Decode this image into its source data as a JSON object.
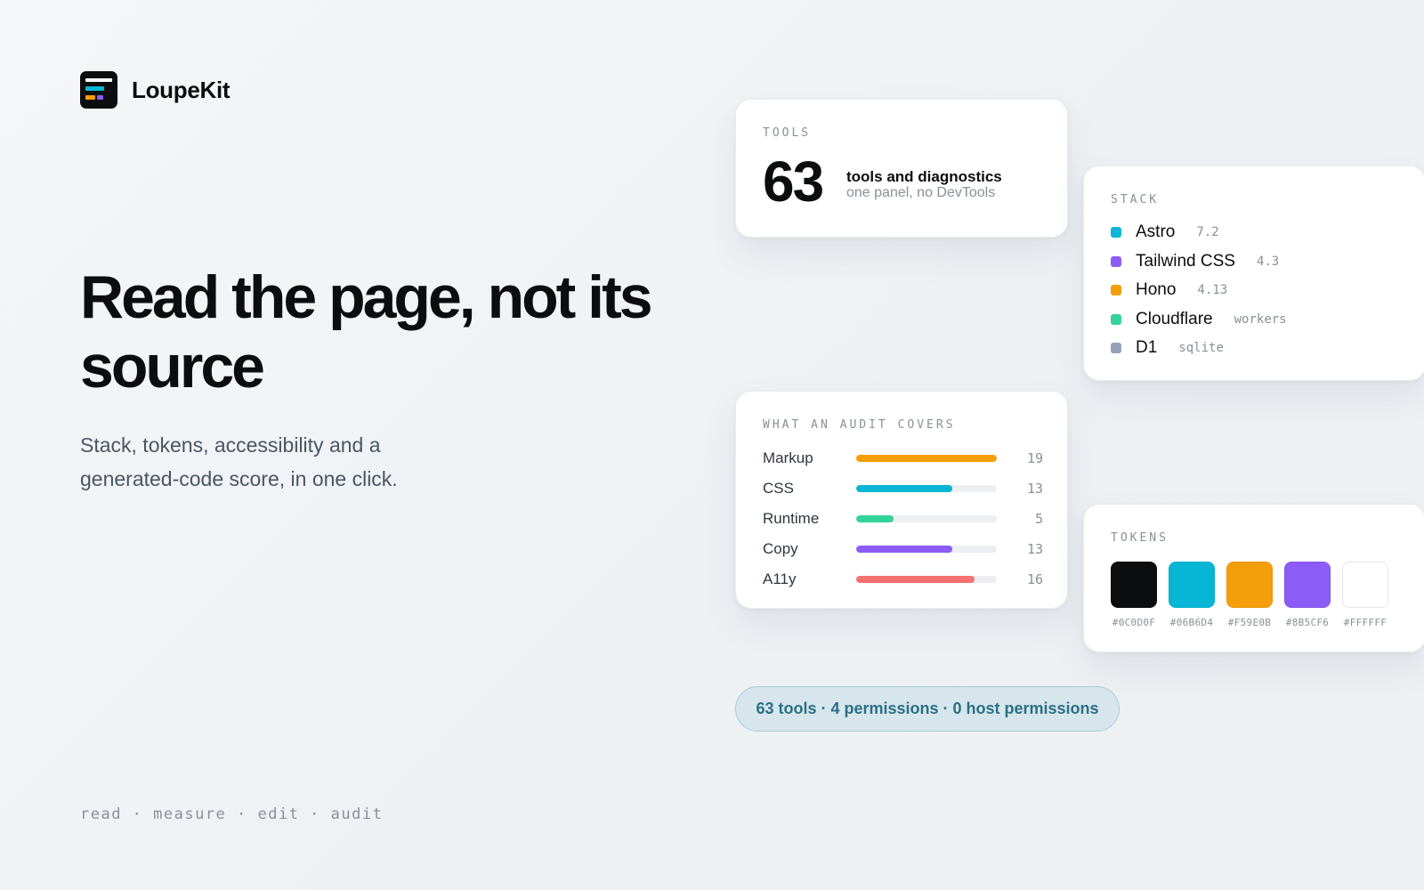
{
  "brand": {
    "name": "LoupeKit"
  },
  "hero": {
    "headline": "Read the page, not its source",
    "subtext": "Stack, tokens, accessibility and a generated-code score, in one click.",
    "tagline": "read · measure · edit · audit"
  },
  "tools_card": {
    "label": "TOOLS",
    "count": "63",
    "title": "tools and diagnostics",
    "subtitle": "one panel, no DevTools"
  },
  "stack_card": {
    "label": "STACK",
    "items": [
      {
        "name": "Astro",
        "version": "7.2",
        "color": "#06B6D4"
      },
      {
        "name": "Tailwind CSS",
        "version": "4.3",
        "color": "#8B5CF6"
      },
      {
        "name": "Hono",
        "version": "4.13",
        "color": "#F59E0B"
      },
      {
        "name": "Cloudflare",
        "version": "workers",
        "color": "#34D399"
      },
      {
        "name": "D1",
        "version": "sqlite",
        "color": "#94A3B8"
      }
    ]
  },
  "audit_card": {
    "label": "WHAT AN AUDIT COVERS",
    "max": 19,
    "rows": [
      {
        "name": "Markup",
        "count": 19,
        "color": "#F59E0B"
      },
      {
        "name": "CSS",
        "count": 13,
        "color": "#06B6D4"
      },
      {
        "name": "Runtime",
        "count": 5,
        "color": "#34D399"
      },
      {
        "name": "Copy",
        "count": 13,
        "color": "#8B5CF6"
      },
      {
        "name": "A11y",
        "count": 16,
        "color": "#F87171"
      }
    ]
  },
  "tokens_card": {
    "label": "TOKENS",
    "swatches": [
      {
        "hex": "#0C0D0F",
        "label": "#0C0D0F"
      },
      {
        "hex": "#06B6D4",
        "label": "#06B6D4"
      },
      {
        "hex": "#F59E0B",
        "label": "#F59E0B"
      },
      {
        "hex": "#8B5CF6",
        "label": "#8B5CF6"
      },
      {
        "hex": "#FFFFFF",
        "label": "#FFFFFF"
      }
    ]
  },
  "summary_pill": {
    "text": "63 tools · 4 permissions · 0 host permissions"
  }
}
